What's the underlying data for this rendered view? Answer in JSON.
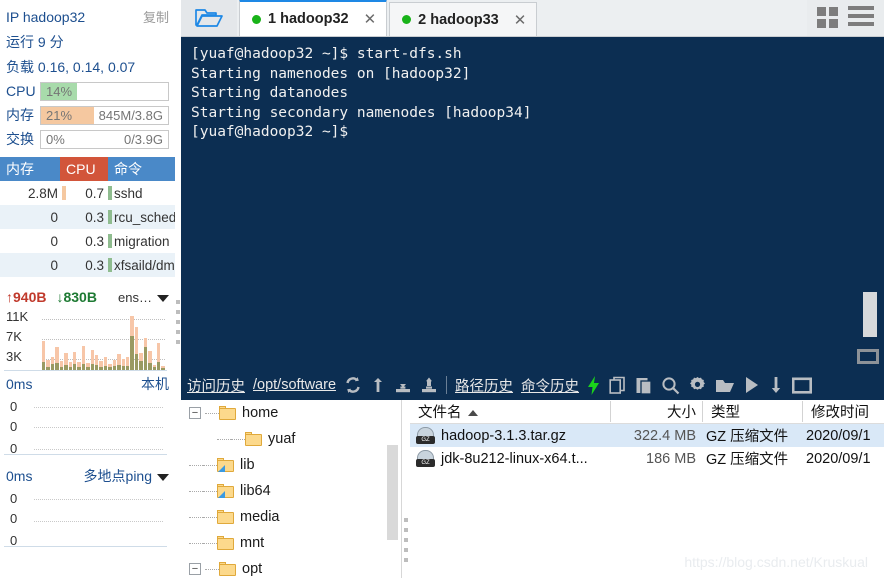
{
  "sidebar": {
    "ip_label": "IP hadoop32",
    "copy_label": "复制",
    "uptime_label": "运行 9 分",
    "load_label": "负载 0.16, 0.14, 0.07",
    "meters": [
      {
        "name": "CPU",
        "label": "CPU",
        "percent": "14%",
        "amount": "",
        "fill_color": "#a8dbab",
        "fill_width": 14
      },
      {
        "name": "内存",
        "label": "内存",
        "percent": "21%",
        "amount": "845M/3.8G",
        "fill_color": "#f5c8a0",
        "fill_width": 21
      },
      {
        "name": "交换",
        "label": "交换",
        "percent": "0%",
        "amount": "0/3.9G",
        "fill_color": "#cccccc",
        "fill_width": 0
      }
    ],
    "process_table": {
      "headers": [
        "内存",
        "CPU",
        "命令"
      ],
      "rows": [
        {
          "mem": "2.8M",
          "cpu": "0.7",
          "cmd": "sshd"
        },
        {
          "mem": "0",
          "cpu": "0.3",
          "cmd": "rcu_sched"
        },
        {
          "mem": "0",
          "cpu": "0.3",
          "cmd": "migration"
        },
        {
          "mem": "0",
          "cpu": "0.3",
          "cmd": "xfsaild/dm"
        }
      ]
    },
    "network": {
      "up": "940B",
      "down": "830B",
      "interface": "ens…",
      "y_labels": [
        "11K",
        "7K",
        "3K"
      ],
      "up_bars": [
        52,
        18,
        23,
        42,
        16,
        30,
        15,
        33,
        14,
        44,
        12,
        36,
        27,
        16,
        24,
        11,
        18,
        28,
        20,
        23,
        97,
        78,
        30,
        58,
        34,
        9,
        48,
        7
      ],
      "down_bars": [
        14,
        6,
        10,
        12,
        5,
        9,
        6,
        10,
        5,
        11,
        5,
        10,
        9,
        5,
        8,
        5,
        7,
        9,
        7,
        8,
        62,
        28,
        16,
        42,
        12,
        5,
        14,
        4
      ]
    },
    "ping_local": {
      "latency": "0ms",
      "name": "本机",
      "y_labels": [
        "0",
        "0",
        "0"
      ]
    },
    "ping_multi": {
      "latency": "0ms",
      "name": "多地点ping",
      "y_labels": [
        "0",
        "0",
        "0"
      ]
    }
  },
  "tabs": {
    "folder_icon": "open-folder-icon",
    "items": [
      {
        "index": "1",
        "label": "1 hadoop32",
        "close": "✕",
        "active": true
      },
      {
        "index": "2",
        "label": "2 hadoop33",
        "close": "✕",
        "active": false
      }
    ],
    "right_icons": [
      "grid-view-icon",
      "list-view-icon"
    ]
  },
  "terminal": {
    "lines": "[yuaf@hadoop32 ~]$ start-dfs.sh\nStarting namenodes on [hadoop32]\nStarting datanodes\nStarting secondary namenodes [hadoop34]\n[yuaf@hadoop32 ~]$ ",
    "background": "#0c2e52",
    "foreground": "#f0f0f0"
  },
  "cmdbar": {
    "visit_history": "访问历史",
    "path": "/opt/software",
    "path_history": "路径历史",
    "command_history": "命令历史",
    "icons": [
      "refresh-icon",
      "upload-arrow-icon",
      "download-icon",
      "upload-icon",
      "lightning-icon",
      "copy-icon",
      "paste-icon",
      "search-icon",
      "gear-icon",
      "folder-icon",
      "play-icon",
      "download-arrow-icon",
      "window-icon"
    ]
  },
  "tree": {
    "nodes": [
      {
        "label": "home",
        "depth": 0,
        "expander": "−",
        "link": false
      },
      {
        "label": "yuaf",
        "depth": 1,
        "expander": "",
        "link": false
      },
      {
        "label": "lib",
        "depth": 0,
        "expander": "",
        "link": true
      },
      {
        "label": "lib64",
        "depth": 0,
        "expander": "",
        "link": true
      },
      {
        "label": "media",
        "depth": 0,
        "expander": "",
        "link": false
      },
      {
        "label": "mnt",
        "depth": 0,
        "expander": "",
        "link": false
      },
      {
        "label": "opt",
        "depth": 0,
        "expander": "−",
        "link": false
      }
    ]
  },
  "filelist": {
    "headers": {
      "name": "文件名",
      "size": "大小",
      "type": "类型",
      "time": "修改时间"
    },
    "sort": "asc",
    "rows": [
      {
        "name": "hadoop-3.1.3.tar.gz",
        "size": "322.4 MB",
        "type": "GZ 压缩文件",
        "time": "2020/09/1",
        "icon": "gz-archive-icon",
        "selected": true
      },
      {
        "name": "jdk-8u212-linux-x64.t...",
        "size": "186 MB",
        "type": "GZ 压缩文件",
        "time": "2020/09/1",
        "icon": "gz-archive-icon",
        "selected": false
      }
    ]
  },
  "watermark": "https://blog.csdn.net/Kruskual"
}
